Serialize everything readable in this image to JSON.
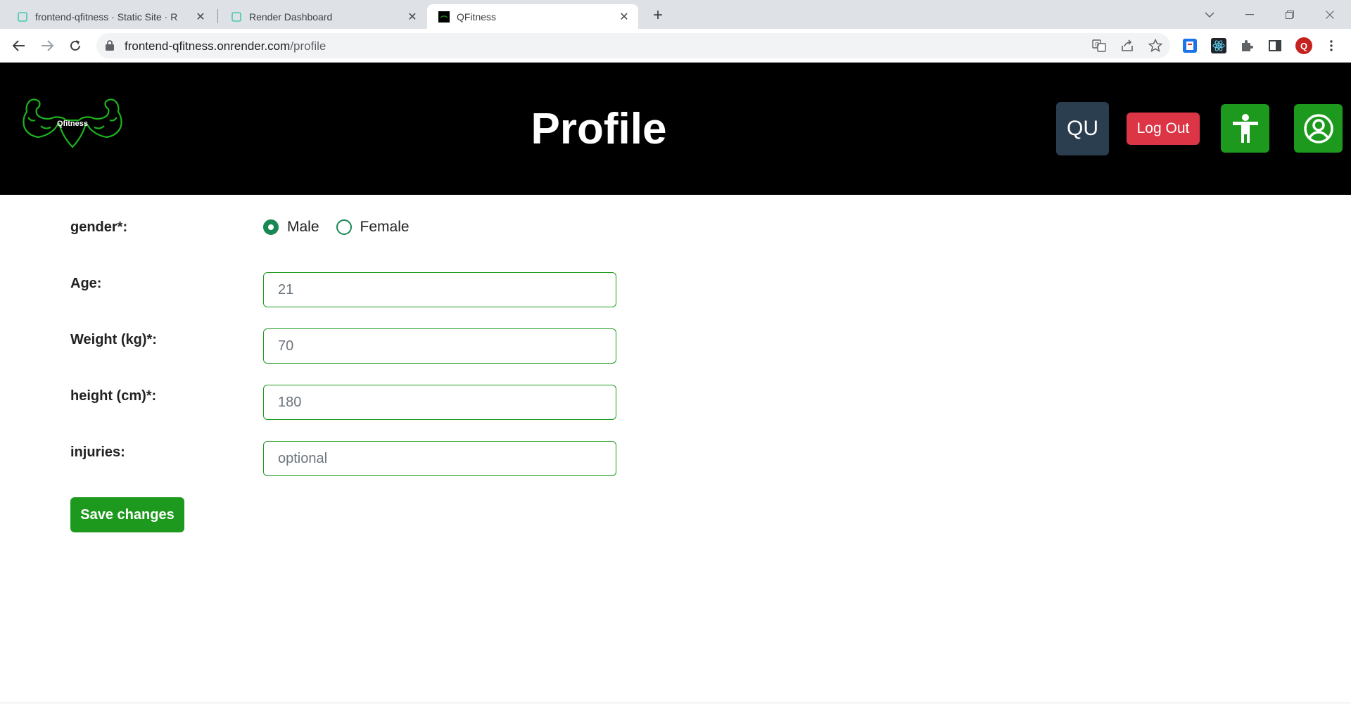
{
  "browser": {
    "tabs": [
      {
        "title": "frontend-qfitness · Static Site · R",
        "active": false
      },
      {
        "title": "Render Dashboard",
        "active": false
      },
      {
        "title": "QFitness",
        "active": true
      }
    ],
    "url_host": "frontend-qfitness.onrender.com",
    "url_path": "/profile",
    "profile_initial": "Q"
  },
  "header": {
    "logo_text": "Qfitness",
    "title": "Profile",
    "user_initials": "QU",
    "logout_label": "Log Out"
  },
  "form": {
    "gender_label": "gender*:",
    "gender_options": [
      "Male",
      "Female"
    ],
    "gender_selected": "Male",
    "age_label": "Age:",
    "age_value": "21",
    "weight_label": "Weight (kg)*:",
    "weight_value": "70",
    "height_label": "height (cm)*:",
    "height_value": "180",
    "injuries_label": "injuries:",
    "injuries_placeholder": "optional",
    "save_label": "Save changes"
  },
  "colors": {
    "accent_green": "#1d9a1d",
    "logout_red": "#dc3545",
    "user_btn": "#2b3e50",
    "header_bg": "#000000"
  }
}
